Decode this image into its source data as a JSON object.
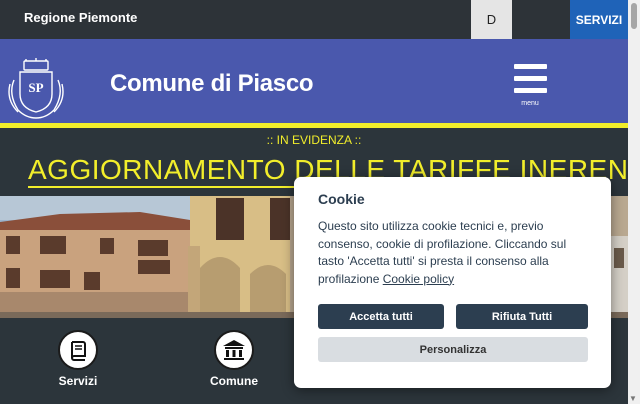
{
  "topbar": {
    "region": "Regione Piemonte",
    "language": "D",
    "services_button": "SERVIZI"
  },
  "header": {
    "title": "Comune di Piasco",
    "menu_label": "menu"
  },
  "evidenza": {
    "label": ":: IN EVIDENZA ::",
    "headline": "AGGIORNAMENTO DELLE TARIFFE INERENTI AL"
  },
  "quick_links": [
    {
      "label": "Servizi",
      "icon": "book-icon"
    },
    {
      "label": "Comune",
      "icon": "building-icon"
    }
  ],
  "cookie": {
    "title": "Cookie",
    "text": "Questo sito utilizza cookie tecnici e, previo consenso, cookie di profilazione. Cliccando sul tasto 'Accetta tutti' si presta il consenso alla profilazione ",
    "policy_link": "Cookie policy",
    "accept_all": "Accetta tutti",
    "reject_all": "Rifiuta Tutti",
    "customize": "Personalizza"
  },
  "colors": {
    "header_blue": "#4a58ad",
    "accent_yellow": "#f2ee2b",
    "dark_bg": "#2c353b",
    "services_blue": "#1f63b8",
    "cookie_button": "#2c3e50"
  }
}
